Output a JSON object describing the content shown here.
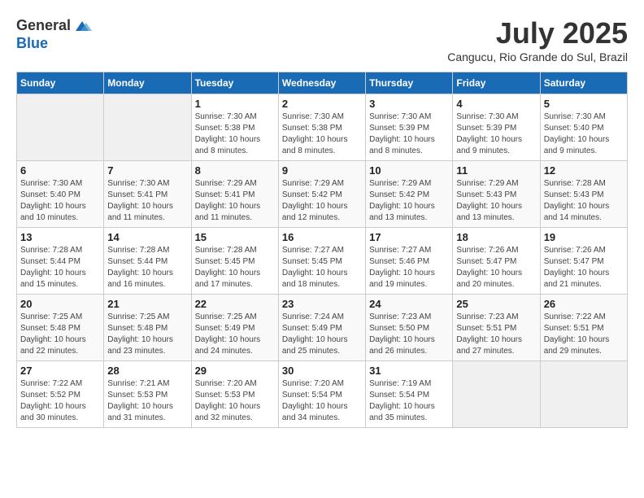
{
  "logo": {
    "general": "General",
    "blue": "Blue"
  },
  "title": "July 2025",
  "location": "Cangucu, Rio Grande do Sul, Brazil",
  "weekdays": [
    "Sunday",
    "Monday",
    "Tuesday",
    "Wednesday",
    "Thursday",
    "Friday",
    "Saturday"
  ],
  "weeks": [
    [
      {
        "day": "",
        "empty": true
      },
      {
        "day": "",
        "empty": true
      },
      {
        "day": "1",
        "sunrise": "Sunrise: 7:30 AM",
        "sunset": "Sunset: 5:38 PM",
        "daylight": "Daylight: 10 hours and 8 minutes."
      },
      {
        "day": "2",
        "sunrise": "Sunrise: 7:30 AM",
        "sunset": "Sunset: 5:38 PM",
        "daylight": "Daylight: 10 hours and 8 minutes."
      },
      {
        "day": "3",
        "sunrise": "Sunrise: 7:30 AM",
        "sunset": "Sunset: 5:39 PM",
        "daylight": "Daylight: 10 hours and 8 minutes."
      },
      {
        "day": "4",
        "sunrise": "Sunrise: 7:30 AM",
        "sunset": "Sunset: 5:39 PM",
        "daylight": "Daylight: 10 hours and 9 minutes."
      },
      {
        "day": "5",
        "sunrise": "Sunrise: 7:30 AM",
        "sunset": "Sunset: 5:40 PM",
        "daylight": "Daylight: 10 hours and 9 minutes."
      }
    ],
    [
      {
        "day": "6",
        "sunrise": "Sunrise: 7:30 AM",
        "sunset": "Sunset: 5:40 PM",
        "daylight": "Daylight: 10 hours and 10 minutes."
      },
      {
        "day": "7",
        "sunrise": "Sunrise: 7:30 AM",
        "sunset": "Sunset: 5:41 PM",
        "daylight": "Daylight: 10 hours and 11 minutes."
      },
      {
        "day": "8",
        "sunrise": "Sunrise: 7:29 AM",
        "sunset": "Sunset: 5:41 PM",
        "daylight": "Daylight: 10 hours and 11 minutes."
      },
      {
        "day": "9",
        "sunrise": "Sunrise: 7:29 AM",
        "sunset": "Sunset: 5:42 PM",
        "daylight": "Daylight: 10 hours and 12 minutes."
      },
      {
        "day": "10",
        "sunrise": "Sunrise: 7:29 AM",
        "sunset": "Sunset: 5:42 PM",
        "daylight": "Daylight: 10 hours and 13 minutes."
      },
      {
        "day": "11",
        "sunrise": "Sunrise: 7:29 AM",
        "sunset": "Sunset: 5:43 PM",
        "daylight": "Daylight: 10 hours and 13 minutes."
      },
      {
        "day": "12",
        "sunrise": "Sunrise: 7:28 AM",
        "sunset": "Sunset: 5:43 PM",
        "daylight": "Daylight: 10 hours and 14 minutes."
      }
    ],
    [
      {
        "day": "13",
        "sunrise": "Sunrise: 7:28 AM",
        "sunset": "Sunset: 5:44 PM",
        "daylight": "Daylight: 10 hours and 15 minutes."
      },
      {
        "day": "14",
        "sunrise": "Sunrise: 7:28 AM",
        "sunset": "Sunset: 5:44 PM",
        "daylight": "Daylight: 10 hours and 16 minutes."
      },
      {
        "day": "15",
        "sunrise": "Sunrise: 7:28 AM",
        "sunset": "Sunset: 5:45 PM",
        "daylight": "Daylight: 10 hours and 17 minutes."
      },
      {
        "day": "16",
        "sunrise": "Sunrise: 7:27 AM",
        "sunset": "Sunset: 5:45 PM",
        "daylight": "Daylight: 10 hours and 18 minutes."
      },
      {
        "day": "17",
        "sunrise": "Sunrise: 7:27 AM",
        "sunset": "Sunset: 5:46 PM",
        "daylight": "Daylight: 10 hours and 19 minutes."
      },
      {
        "day": "18",
        "sunrise": "Sunrise: 7:26 AM",
        "sunset": "Sunset: 5:47 PM",
        "daylight": "Daylight: 10 hours and 20 minutes."
      },
      {
        "day": "19",
        "sunrise": "Sunrise: 7:26 AM",
        "sunset": "Sunset: 5:47 PM",
        "daylight": "Daylight: 10 hours and 21 minutes."
      }
    ],
    [
      {
        "day": "20",
        "sunrise": "Sunrise: 7:25 AM",
        "sunset": "Sunset: 5:48 PM",
        "daylight": "Daylight: 10 hours and 22 minutes."
      },
      {
        "day": "21",
        "sunrise": "Sunrise: 7:25 AM",
        "sunset": "Sunset: 5:48 PM",
        "daylight": "Daylight: 10 hours and 23 minutes."
      },
      {
        "day": "22",
        "sunrise": "Sunrise: 7:25 AM",
        "sunset": "Sunset: 5:49 PM",
        "daylight": "Daylight: 10 hours and 24 minutes."
      },
      {
        "day": "23",
        "sunrise": "Sunrise: 7:24 AM",
        "sunset": "Sunset: 5:49 PM",
        "daylight": "Daylight: 10 hours and 25 minutes."
      },
      {
        "day": "24",
        "sunrise": "Sunrise: 7:23 AM",
        "sunset": "Sunset: 5:50 PM",
        "daylight": "Daylight: 10 hours and 26 minutes."
      },
      {
        "day": "25",
        "sunrise": "Sunrise: 7:23 AM",
        "sunset": "Sunset: 5:51 PM",
        "daylight": "Daylight: 10 hours and 27 minutes."
      },
      {
        "day": "26",
        "sunrise": "Sunrise: 7:22 AM",
        "sunset": "Sunset: 5:51 PM",
        "daylight": "Daylight: 10 hours and 29 minutes."
      }
    ],
    [
      {
        "day": "27",
        "sunrise": "Sunrise: 7:22 AM",
        "sunset": "Sunset: 5:52 PM",
        "daylight": "Daylight: 10 hours and 30 minutes."
      },
      {
        "day": "28",
        "sunrise": "Sunrise: 7:21 AM",
        "sunset": "Sunset: 5:53 PM",
        "daylight": "Daylight: 10 hours and 31 minutes."
      },
      {
        "day": "29",
        "sunrise": "Sunrise: 7:20 AM",
        "sunset": "Sunset: 5:53 PM",
        "daylight": "Daylight: 10 hours and 32 minutes."
      },
      {
        "day": "30",
        "sunrise": "Sunrise: 7:20 AM",
        "sunset": "Sunset: 5:54 PM",
        "daylight": "Daylight: 10 hours and 34 minutes."
      },
      {
        "day": "31",
        "sunrise": "Sunrise: 7:19 AM",
        "sunset": "Sunset: 5:54 PM",
        "daylight": "Daylight: 10 hours and 35 minutes."
      },
      {
        "day": "",
        "empty": true
      },
      {
        "day": "",
        "empty": true
      }
    ]
  ]
}
